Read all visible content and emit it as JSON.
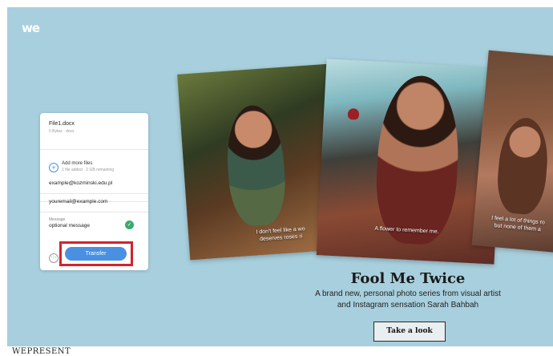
{
  "brand": {
    "logo_text": "we"
  },
  "upload_panel": {
    "file": {
      "name": "File1.docx",
      "meta": "0 Bytes · docx"
    },
    "add_files": {
      "label": "Add more files",
      "meta": "1 file added · 2 GB remaining"
    },
    "email_to": "example@kozminski.edu.pl",
    "email_from": "youremail@example.com",
    "message": {
      "label": "Message",
      "value": "optional message"
    },
    "transfer_label": "Transfer"
  },
  "photos": [
    {
      "caption_line1": "I don't feel like a wo",
      "caption_line2": "deserves roses ri"
    },
    {
      "caption": "A flower to remember me."
    },
    {
      "caption_line1": "I feel a lot of things ro",
      "caption_line2": "but none of them a"
    }
  ],
  "promo": {
    "title": "Fool Me Twice",
    "subtitle_line1": "A brand new, personal photo series from visual artist",
    "subtitle_line2": "and Instagram sensation Sarah Bahbah",
    "cta_label": "Take a look"
  },
  "footer": {
    "section_label": "WEPRESENT"
  },
  "colors": {
    "background": "#a8cfdd",
    "accent": "#4a90e2",
    "highlight": "#d2232a",
    "check": "#3aaa6b"
  }
}
